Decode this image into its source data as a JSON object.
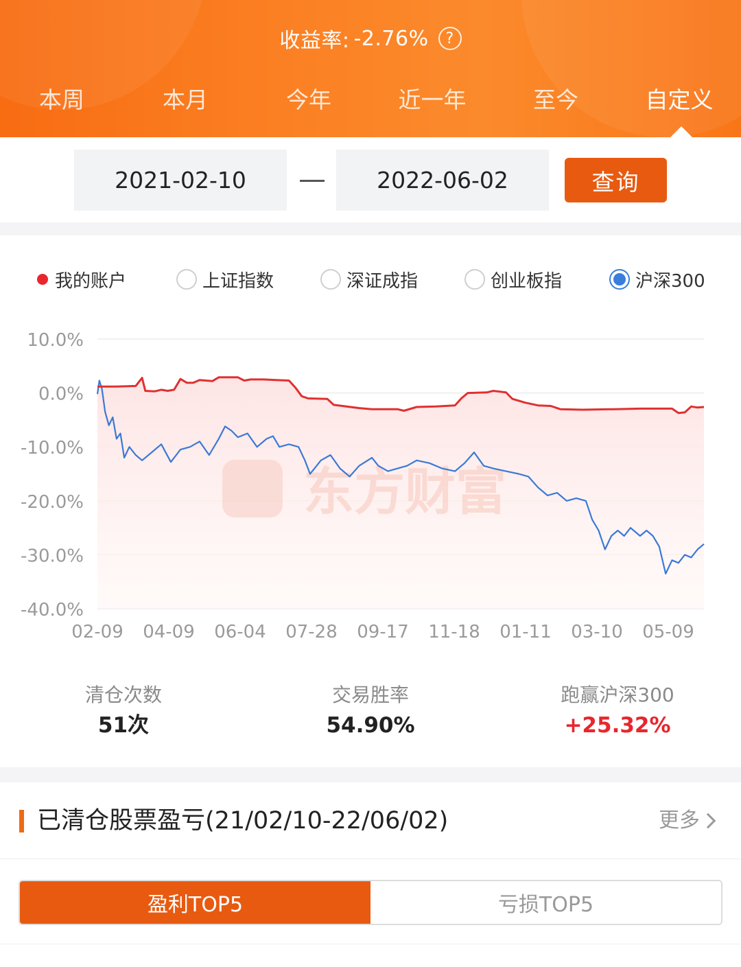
{
  "header": {
    "yield_label": "收益率:",
    "yield_value": "-2.76%",
    "help_icon_glyph": "?",
    "tabs": [
      "本周",
      "本月",
      "今年",
      "近一年",
      "至今",
      "自定义"
    ],
    "active_tab": "自定义"
  },
  "query": {
    "start_date": "2021-02-10",
    "end_date": "2022-06-02",
    "button_label": "查询"
  },
  "legend": {
    "items": [
      {
        "label": "我的账户",
        "kind": "dot",
        "color": "#e8262d"
      },
      {
        "label": "上证指数",
        "kind": "radio",
        "checked": false
      },
      {
        "label": "深证成指",
        "kind": "radio",
        "checked": false
      },
      {
        "label": "创业板指",
        "kind": "radio",
        "checked": false
      },
      {
        "label": "沪深300",
        "kind": "radio",
        "checked": true
      }
    ]
  },
  "chart_data": {
    "type": "line",
    "ylim": [
      -40,
      10
    ],
    "yticks": [
      "10.0%",
      "0.0%",
      "-10.0%",
      "-20.0%",
      "-30.0%",
      "-40.0%"
    ],
    "ytick_values": [
      10,
      0,
      -10,
      -20,
      -30,
      -40
    ],
    "xticks": [
      "02-09",
      "04-09",
      "06-04",
      "07-28",
      "09-17",
      "11-18",
      "01-11",
      "03-10",
      "05-09"
    ],
    "watermark": "东方财富",
    "grid": true,
    "series": [
      {
        "name": "我的账户",
        "color": "#e03030",
        "points": [
          [
            0.0,
            1.2
          ],
          [
            3.0,
            1.2
          ],
          [
            6.0,
            1.3
          ],
          [
            7.0,
            2.8
          ],
          [
            7.5,
            0.4
          ],
          [
            9.0,
            0.3
          ],
          [
            10.0,
            0.6
          ],
          [
            11.0,
            0.4
          ],
          [
            12.0,
            0.6
          ],
          [
            13.0,
            2.6
          ],
          [
            14.0,
            1.9
          ],
          [
            15.0,
            1.9
          ],
          [
            16.0,
            2.4
          ],
          [
            18.0,
            2.2
          ],
          [
            19.0,
            2.9
          ],
          [
            22.0,
            2.9
          ],
          [
            23.0,
            2.3
          ],
          [
            24.0,
            2.5
          ],
          [
            26.0,
            2.5
          ],
          [
            28.0,
            2.4
          ],
          [
            30.0,
            2.3
          ],
          [
            31.0,
            1.0
          ],
          [
            32.0,
            -0.6
          ],
          [
            33.0,
            -1.0
          ],
          [
            36.0,
            -1.1
          ],
          [
            37.0,
            -2.2
          ],
          [
            39.0,
            -2.5
          ],
          [
            41.0,
            -2.8
          ],
          [
            43.0,
            -3.0
          ],
          [
            47.0,
            -3.0
          ],
          [
            48.0,
            -3.3
          ],
          [
            50.0,
            -2.6
          ],
          [
            53.0,
            -2.5
          ],
          [
            56.0,
            -2.3
          ],
          [
            57.0,
            -1.0
          ],
          [
            58.0,
            0.0
          ],
          [
            61.0,
            0.1
          ],
          [
            62.0,
            0.4
          ],
          [
            64.0,
            0.1
          ],
          [
            65.0,
            -1.1
          ],
          [
            67.0,
            -1.8
          ],
          [
            69.0,
            -2.3
          ],
          [
            71.0,
            -2.4
          ],
          [
            72.5,
            -3.0
          ],
          [
            76.0,
            -3.1
          ],
          [
            81.0,
            -3.0
          ],
          [
            85.0,
            -2.9
          ],
          [
            90.0,
            -2.9
          ],
          [
            91.0,
            -3.7
          ],
          [
            92.0,
            -3.6
          ],
          [
            93.0,
            -2.5
          ],
          [
            94.0,
            -2.7
          ],
          [
            95.0,
            -2.6
          ]
        ]
      },
      {
        "name": "沪深300",
        "color": "#3b78d6",
        "points": [
          [
            0.0,
            -0.2
          ],
          [
            0.3,
            2.3
          ],
          [
            0.7,
            0.8
          ],
          [
            1.2,
            -3.5
          ],
          [
            1.8,
            -6.0
          ],
          [
            2.4,
            -4.5
          ],
          [
            3.0,
            -8.5
          ],
          [
            3.6,
            -7.5
          ],
          [
            4.2,
            -12.0
          ],
          [
            5.0,
            -10.0
          ],
          [
            6.0,
            -11.5
          ],
          [
            7.0,
            -12.5
          ],
          [
            8.5,
            -11.0
          ],
          [
            10.0,
            -9.5
          ],
          [
            11.5,
            -12.8
          ],
          [
            13.0,
            -10.5
          ],
          [
            14.5,
            -10.0
          ],
          [
            16.0,
            -9.0
          ],
          [
            17.5,
            -11.5
          ],
          [
            19.0,
            -8.5
          ],
          [
            20.0,
            -6.2
          ],
          [
            21.0,
            -7.0
          ],
          [
            22.0,
            -8.2
          ],
          [
            23.5,
            -7.5
          ],
          [
            25.0,
            -10.0
          ],
          [
            26.5,
            -8.5
          ],
          [
            27.5,
            -8.0
          ],
          [
            28.5,
            -10.0
          ],
          [
            30.0,
            -9.5
          ],
          [
            31.5,
            -10.0
          ],
          [
            32.5,
            -12.5
          ],
          [
            33.3,
            -15.0
          ],
          [
            34.0,
            -14.0
          ],
          [
            35.0,
            -12.5
          ],
          [
            36.5,
            -11.5
          ],
          [
            38.0,
            -14.0
          ],
          [
            39.5,
            -15.5
          ],
          [
            41.0,
            -13.5
          ],
          [
            43.0,
            -12.0
          ],
          [
            44.0,
            -13.5
          ],
          [
            45.5,
            -14.5
          ],
          [
            47.0,
            -14.0
          ],
          [
            48.5,
            -13.5
          ],
          [
            50.0,
            -12.5
          ],
          [
            52.0,
            -13.0
          ],
          [
            54.0,
            -14.0
          ],
          [
            56.0,
            -14.5
          ],
          [
            57.5,
            -13.0
          ],
          [
            59.0,
            -11.0
          ],
          [
            60.5,
            -13.5
          ],
          [
            62.0,
            -14.0
          ],
          [
            64.0,
            -14.5
          ],
          [
            66.0,
            -15.0
          ],
          [
            67.5,
            -15.5
          ],
          [
            69.0,
            -17.5
          ],
          [
            70.5,
            -19.0
          ],
          [
            72.0,
            -18.5
          ],
          [
            73.5,
            -20.0
          ],
          [
            75.0,
            -19.5
          ],
          [
            76.5,
            -20.0
          ],
          [
            77.5,
            -23.5
          ],
          [
            78.5,
            -25.5
          ],
          [
            79.5,
            -29.0
          ],
          [
            80.5,
            -26.5
          ],
          [
            81.5,
            -25.5
          ],
          [
            82.5,
            -26.5
          ],
          [
            83.5,
            -25.0
          ],
          [
            85.0,
            -26.5
          ],
          [
            86.0,
            -25.5
          ],
          [
            87.0,
            -26.5
          ],
          [
            88.0,
            -28.5
          ],
          [
            89.0,
            -33.5
          ],
          [
            90.0,
            -31.0
          ],
          [
            91.0,
            -31.5
          ],
          [
            92.0,
            -30.0
          ],
          [
            93.0,
            -30.5
          ],
          [
            94.0,
            -29.0
          ],
          [
            95.0,
            -28.0
          ]
        ]
      }
    ]
  },
  "stats": [
    {
      "label": "清仓次数",
      "value": "51次"
    },
    {
      "label": "交易胜率",
      "value": "54.90%"
    },
    {
      "label": "跑赢沪深300",
      "value": "+25.32%"
    }
  ],
  "cleared": {
    "title": "已清仓股票盈亏(21/02/10-22/06/02)",
    "more_label": "更多",
    "toggle": [
      "盈利TOP5",
      "亏损TOP5"
    ]
  }
}
